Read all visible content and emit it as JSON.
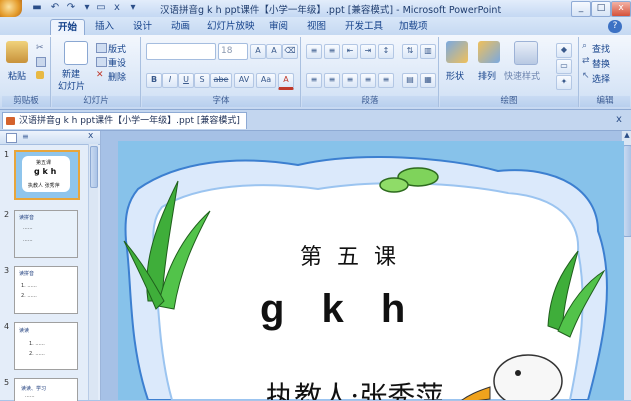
{
  "titlebar": {
    "title": "汉语拼音g k h ppt课件【小学一年级】.ppt [兼容模式] - Microsoft PowerPoint",
    "undo_glyph": "↶",
    "redo_glyph": "↷",
    "save_glyph": "▬",
    "minimize_glyph": "_",
    "maximize_glyph": "□",
    "close_glyph": "x"
  },
  "tabs": [
    "开始",
    "插入",
    "设计",
    "动画",
    "幻灯片放映",
    "审阅",
    "视图",
    "开发工具",
    "加载项"
  ],
  "ribbon": {
    "clipboard": {
      "label": "剪贴板",
      "paste": "粘贴"
    },
    "slides": {
      "label": "幻灯片",
      "new_slide_1": "新建",
      "new_slide_2": "幻灯片",
      "layout": "版式",
      "reset": "重设",
      "delete": "删除"
    },
    "font": {
      "label": "字体",
      "size_value": "18",
      "grow": "A",
      "shrink": "A",
      "bold": "B",
      "italic": "I",
      "underline": "U",
      "shadow": "S",
      "strike": "abe",
      "spacing": "AV",
      "case": "Aa",
      "color": "A"
    },
    "paragraph": {
      "label": "段落"
    },
    "drawing": {
      "label": "绘图",
      "shapes": "形状",
      "arrange": "排列",
      "quick_styles": "快速样式"
    },
    "editing": {
      "label": "编辑",
      "find": "查找",
      "replace": "替换",
      "select": "选择"
    },
    "help_glyph": "?"
  },
  "document_tab": {
    "title": "汉语拼音g k h ppt课件【小学一年级】.ppt [兼容模式]",
    "close_glyph": "x"
  },
  "left_pane": {
    "slides": [
      {
        "num": "1",
        "lines": [
          "第五课",
          "g k h",
          "执教人 张秀萍"
        ]
      },
      {
        "num": "2",
        "lines": [
          "读拼音",
          "......",
          "......"
        ]
      },
      {
        "num": "3",
        "lines": [
          "读拼音",
          "1. ......",
          "2. ......"
        ]
      },
      {
        "num": "4",
        "lines": [
          "读读",
          "1. ......",
          "2. ......"
        ]
      },
      {
        "num": "5",
        "lines": [
          "读读、学习",
          "......"
        ]
      }
    ]
  },
  "slide": {
    "lesson": "第 五 课",
    "letters": "g k h",
    "teacher": "执教人:张秀萍"
  },
  "colors": {
    "accent": "#15428b",
    "tab_active": "#eef4fd",
    "slide_bg": "#87c2ea",
    "frame_white": "#ffffff",
    "selected_thumb_border": "#e8a53a"
  }
}
